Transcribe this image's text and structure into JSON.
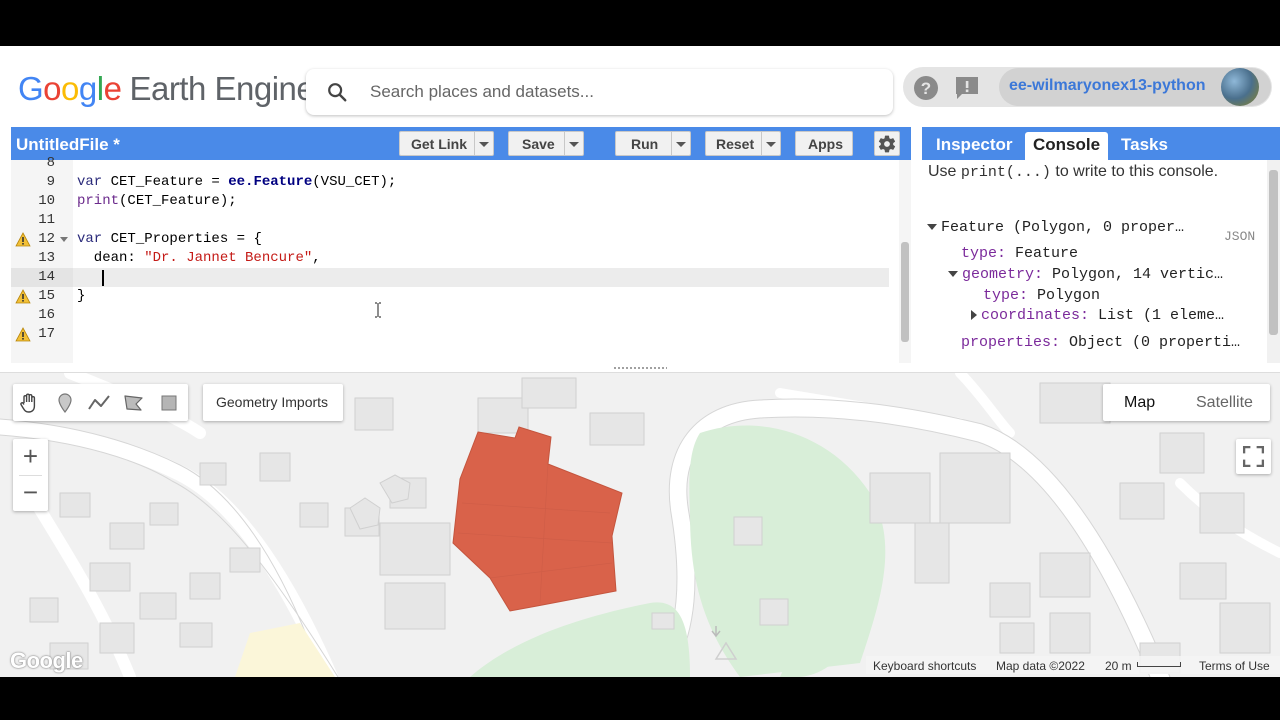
{
  "header": {
    "logo_google": [
      "G",
      "o",
      "o",
      "g",
      "l",
      "e"
    ],
    "logo_google_colors": [
      "#4285F4",
      "#EA4335",
      "#FBBC05",
      "#4285F4",
      "#34A853",
      "#EA4335"
    ],
    "logo_product": "Earth Engine",
    "search_placeholder": "Search places and datasets...",
    "user": "ee-wilmaryonex13-python",
    "icons": [
      "help-icon",
      "feedback-icon"
    ]
  },
  "editor": {
    "file_title": "UntitledFile *",
    "buttons": {
      "get_link": "Get Link",
      "save": "Save",
      "run": "Run",
      "reset": "Reset",
      "apps": "Apps"
    },
    "line_numbers": [
      "8",
      "9",
      "10",
      "11",
      "12",
      "13",
      "14",
      "15",
      "16",
      "17"
    ],
    "warning_lines": [
      "12",
      "15",
      "17"
    ],
    "active_line": "14",
    "code": {
      "l9_kw": "var",
      "l9_a": " CET_Feature = ",
      "l9_cls": "ee.Feature",
      "l9_b": "(VSU_CET);",
      "l10_fn": "print",
      "l10_b": "(CET_Feature);",
      "l12_kw": "var",
      "l12_b": " CET_Properties = {",
      "l13_a": "  dean: ",
      "l13_str": "\"Dr. Jannet Bencure\"",
      "l13_b": ",",
      "l15": "}"
    }
  },
  "right_panel": {
    "tabs": [
      "Inspector",
      "Console",
      "Tasks"
    ],
    "active_tab": "Console",
    "hint_pre": "Use ",
    "hint_code": "print(...)",
    "hint_post": " to write to this console.",
    "json_tag": "JSON",
    "tree": {
      "root": "Feature (Polygon, 0 proper…",
      "type_key": "type:",
      "type_val": " Feature",
      "geometry_key": "geometry:",
      "geometry_val": " Polygon, 14 vertic…",
      "geo_type_key": "type:",
      "geo_type_val": " Polygon",
      "coords_key": "coordinates:",
      "coords_val": " List (1 eleme…",
      "props_key": "properties:",
      "props_val": " Object (0 properti…"
    }
  },
  "map": {
    "geometry_imports": "Geometry Imports",
    "map_type": {
      "map": "Map",
      "satellite": "Satellite",
      "selected": "Map"
    },
    "zoom_in": "+",
    "zoom_out": "−",
    "watermark": "Google",
    "attribution": {
      "shortcuts": "Keyboard shortcuts",
      "data": "Map data ©2022",
      "scale": "20 m",
      "terms": "Terms of Use"
    },
    "polygon_color": "#d9624a",
    "park_color": "#d8eed8"
  }
}
